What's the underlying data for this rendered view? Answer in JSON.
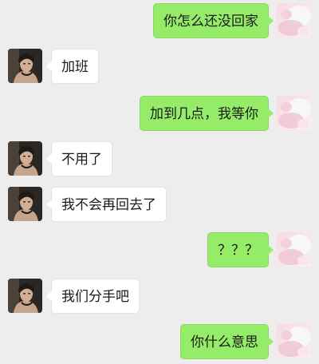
{
  "colors": {
    "background": "#ededed",
    "sent_bubble": "#95ec69",
    "received_bubble": "#ffffff"
  },
  "messages": [
    {
      "side": "right",
      "text": "你怎么还没回家"
    },
    {
      "side": "left",
      "text": "加班"
    },
    {
      "side": "right",
      "text": "加到几点，我等你"
    },
    {
      "side": "left",
      "text": "不用了"
    },
    {
      "side": "left",
      "text": "我不会再回去了"
    },
    {
      "side": "right",
      "text": "？？？"
    },
    {
      "side": "left",
      "text": "我们分手吧"
    },
    {
      "side": "right",
      "text": "你什么意思"
    }
  ],
  "avatars": {
    "self": "pink-abstract-avatar",
    "contact": "man-photo-avatar"
  }
}
